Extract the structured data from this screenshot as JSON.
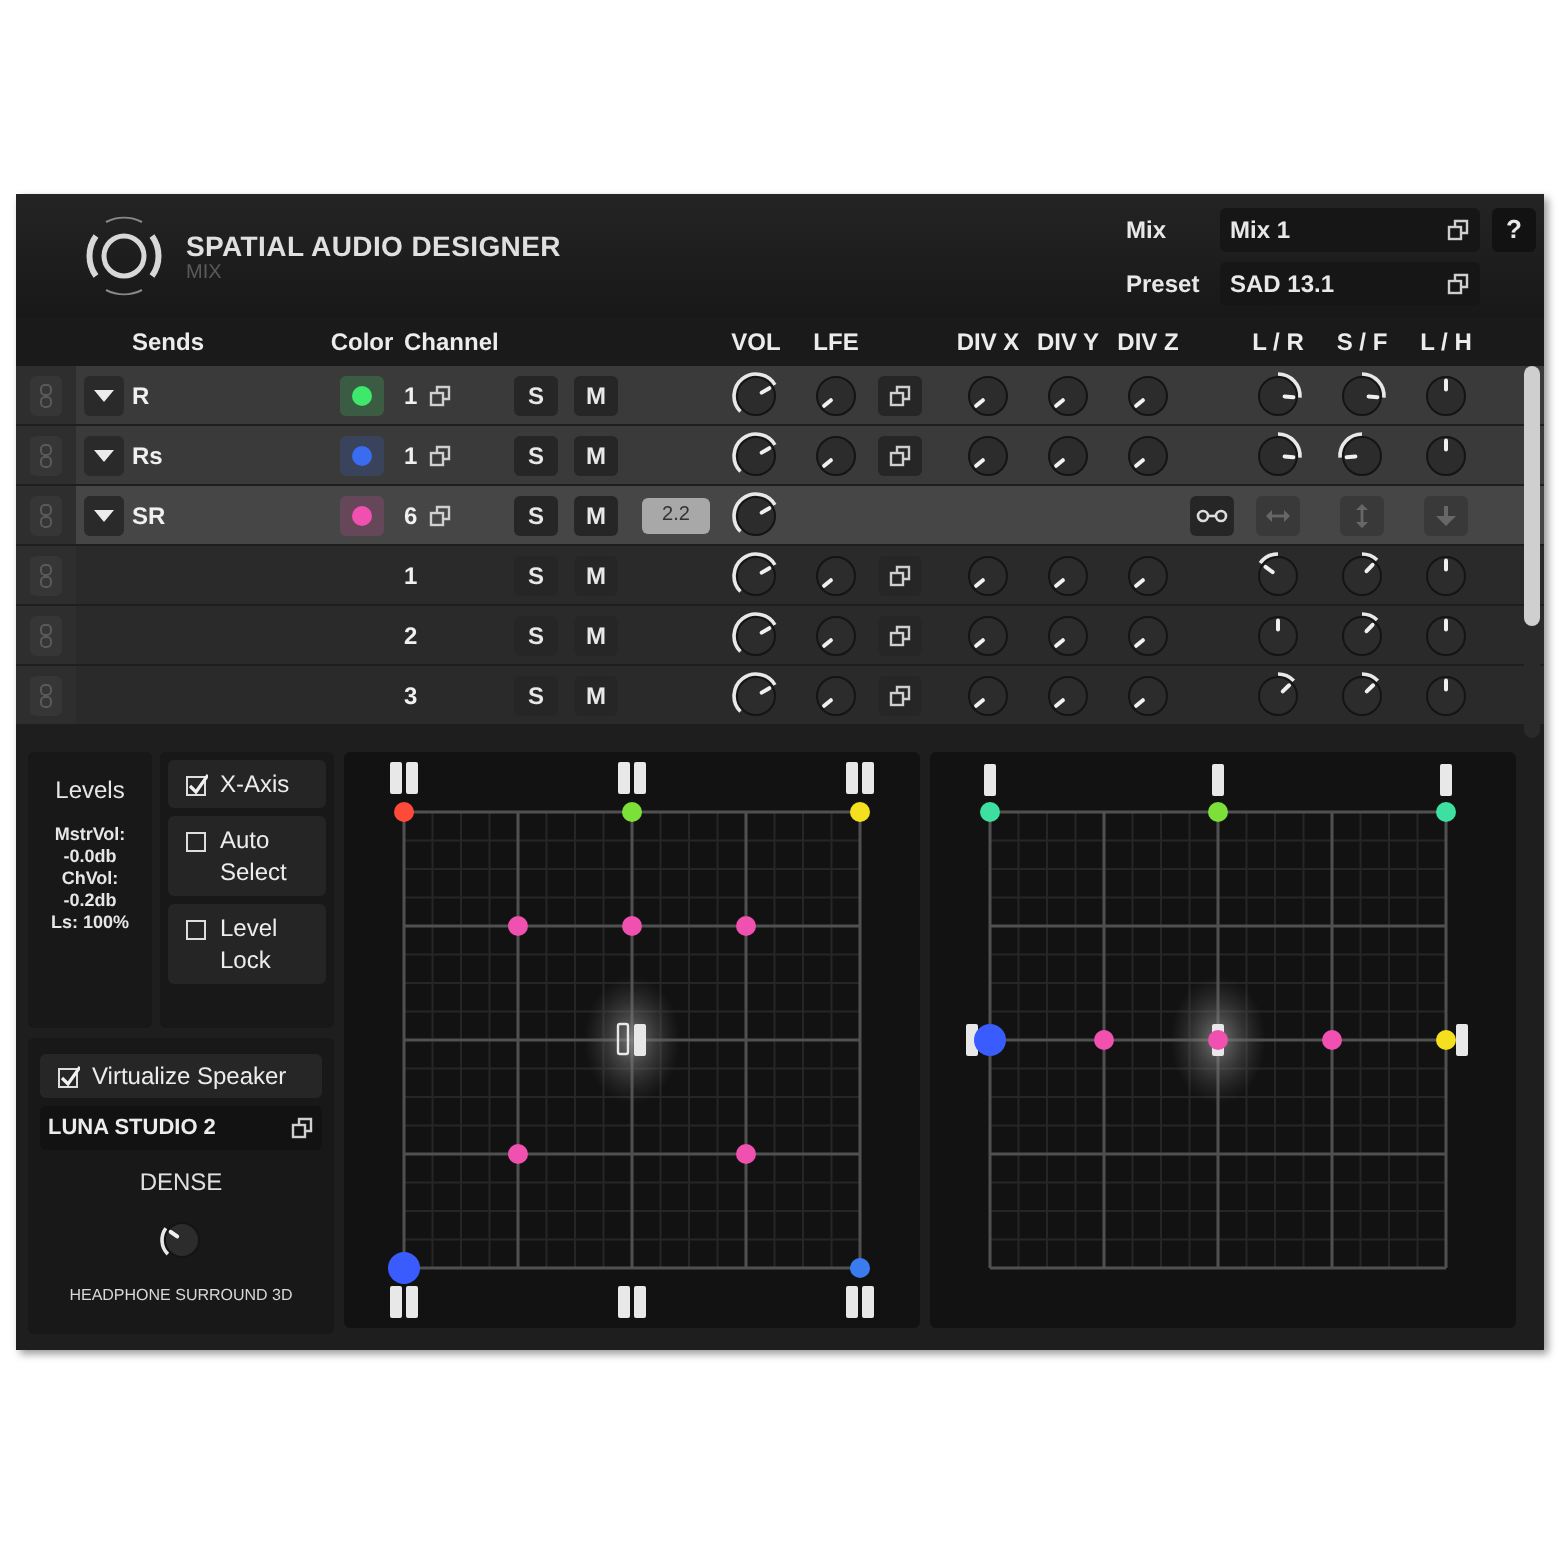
{
  "header": {
    "title": "SPATIAL AUDIO DESIGNER",
    "subtitle": "MIX"
  },
  "mix": {
    "label": "Mix",
    "value": "Mix 1"
  },
  "preset": {
    "label": "Preset",
    "value": "SAD 13.1"
  },
  "help": "?",
  "columns": [
    "Sends",
    "Color",
    "Channel",
    "VOL",
    "LFE",
    "DIV X",
    "DIV Y",
    "DIV Z",
    "L / R",
    "S / F",
    "L / H"
  ],
  "rows": [
    {
      "kind": "send",
      "name": "R",
      "color": "#3ee86a",
      "channel": "1",
      "solo": "S",
      "mute": "M",
      "selected": false
    },
    {
      "kind": "send",
      "name": "Rs",
      "color": "#3a6cf0",
      "channel": "1",
      "solo": "S",
      "mute": "M",
      "selected": false
    },
    {
      "kind": "group",
      "name": "SR",
      "color": "#f050b0",
      "channel": "6",
      "solo": "S",
      "mute": "M",
      "selected": true,
      "tooltip": "2.2"
    },
    {
      "kind": "channel",
      "channel": "1",
      "solo": "S",
      "mute": "M",
      "selected": false
    },
    {
      "kind": "channel",
      "channel": "2",
      "solo": "S",
      "mute": "M",
      "selected": false
    },
    {
      "kind": "channel",
      "channel": "3",
      "solo": "S",
      "mute": "M",
      "selected": false
    }
  ],
  "levels": {
    "title": "Levels",
    "lines": [
      "MstrVol:",
      "-0.0db",
      "ChVol:",
      "-0.2db",
      "Ls: 100%"
    ]
  },
  "options": [
    {
      "label": "X-Axis",
      "checked": true
    },
    {
      "label": "Auto Select",
      "checked": false
    },
    {
      "label": "Level Lock",
      "checked": false
    }
  ],
  "virtualizer": {
    "label": "Virtualize Speaker",
    "checked": true,
    "device": "LUNA STUDIO 2",
    "mode": "DENSE",
    "caption": "HEADPHONE SURROUND 3D"
  },
  "top_view": {
    "speakers": [
      {
        "color": "#ff4a3a",
        "selected": false
      },
      {
        "color": "#7de03a",
        "selected": false
      },
      {
        "color": "#f5e020",
        "selected": false
      },
      {
        "color": "#f050b0",
        "selected": false
      },
      {
        "color": "#f050b0",
        "selected": false
      },
      {
        "color": "#f050b0",
        "selected": false
      },
      {
        "color": "#f050b0",
        "selected": false
      },
      {
        "color": "#f050b0",
        "selected": false
      },
      {
        "color": "#3a5cff",
        "selected": true
      },
      {
        "color": "#3a7cf0",
        "selected": false
      }
    ]
  },
  "side_view": {
    "speakers": [
      {
        "color": "#3de0a0",
        "selected": false
      },
      {
        "color": "#7de03a",
        "selected": false
      },
      {
        "color": "#3de0a0",
        "selected": false
      },
      {
        "color": "#3a5cff",
        "selected": true
      },
      {
        "color": "#f050b0",
        "selected": false
      },
      {
        "color": "#f050b0",
        "selected": false
      },
      {
        "color": "#f050b0",
        "selected": false
      },
      {
        "color": "#f5e020",
        "selected": false
      }
    ]
  }
}
